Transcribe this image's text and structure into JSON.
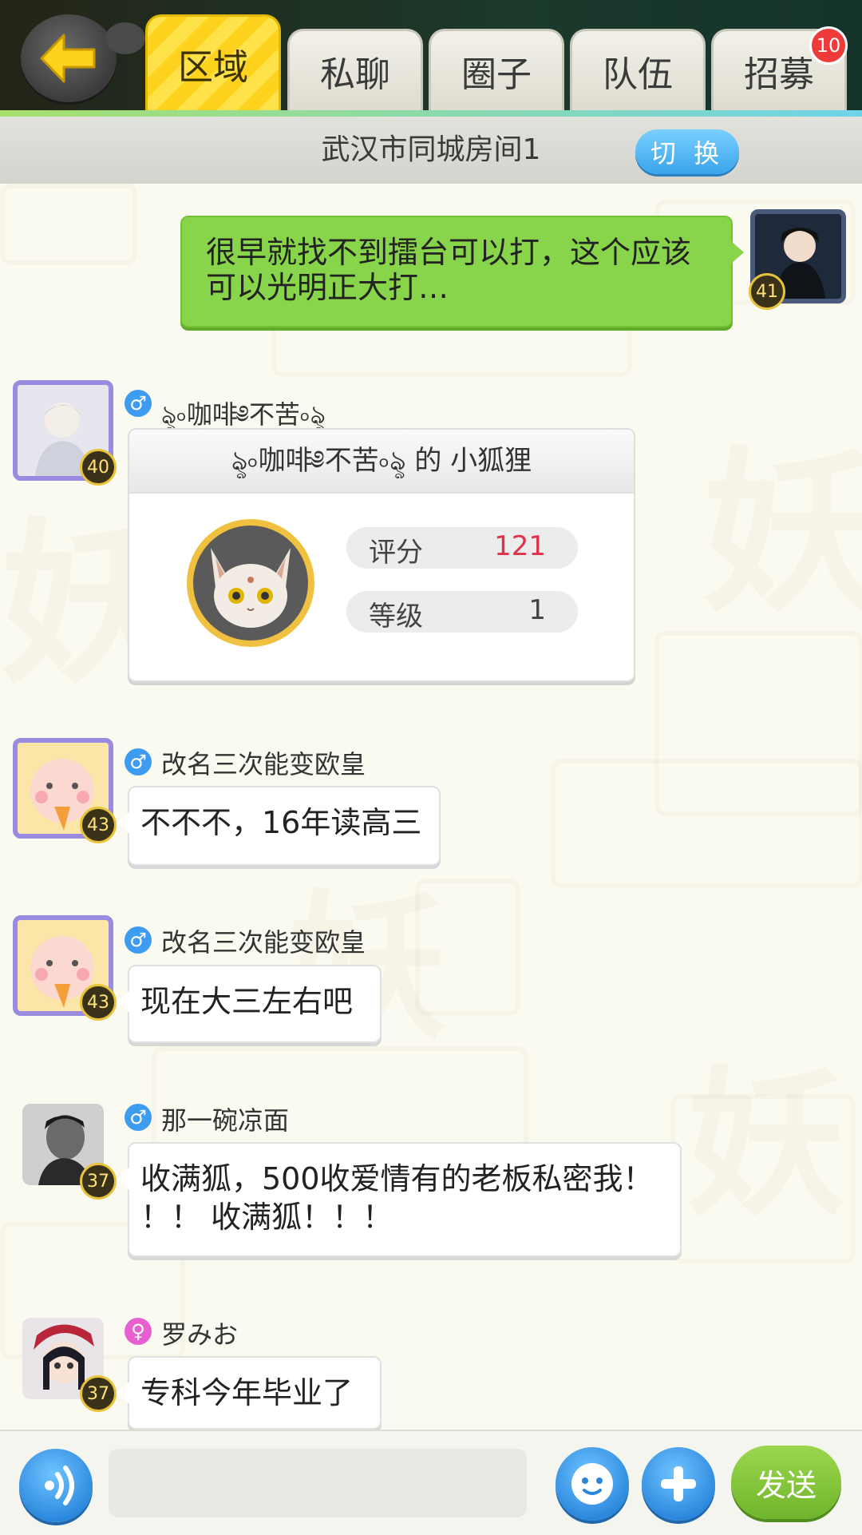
{
  "header": {
    "tabs": [
      {
        "label": "区域",
        "active": true
      },
      {
        "label": "私聊"
      },
      {
        "label": "圈子"
      },
      {
        "label": "队伍"
      },
      {
        "label": "招募",
        "badge": "10"
      }
    ]
  },
  "room": {
    "name": "武汉市同城房间1",
    "switch_label": "切 换"
  },
  "messages": [
    {
      "self": true,
      "level": "41",
      "text": "很早就找不到擂台可以打，这个应该可以光明正大打…"
    },
    {
      "gender": "male",
      "nick": "ৡ৹咖啡༅不苦৹ৡ",
      "level": "40"
    },
    {
      "gender": "male",
      "nick": "改名三次能变欧皇",
      "level": "43",
      "text": "不不不，16年读高三"
    },
    {
      "gender": "male",
      "nick": "改名三次能变欧皇",
      "level": "43",
      "text": "现在大三左右吧"
    },
    {
      "gender": "male",
      "nick": "那一碗凉面",
      "level": "37",
      "text_line1": "收满狐，500收爱情有的老板私密我！",
      "text_line2": "！！ 收满狐！！！"
    },
    {
      "gender": "female",
      "nick": "罗みお",
      "level": "37",
      "text": "专科今年毕业了"
    }
  ],
  "pet_card": {
    "title": "ৡ৹咖啡༅不苦৹ৡ 的 小狐狸",
    "score_label": "评分",
    "score_value": "121",
    "level_label": "等级",
    "level_value": "1"
  },
  "gender_symbols": {
    "male": "♂",
    "female": "♀"
  },
  "input": {
    "value": "",
    "placeholder": ""
  },
  "send_label": "发送",
  "icons": [
    "back-arrow-icon",
    "voice-icon",
    "emoji-icon",
    "plus-icon"
  ],
  "colors": {
    "accent_yellow": "#ffd21e",
    "green_bubble": "#88d44a",
    "blue_button": "#3aa4ec",
    "score_red": "#e0304a"
  }
}
